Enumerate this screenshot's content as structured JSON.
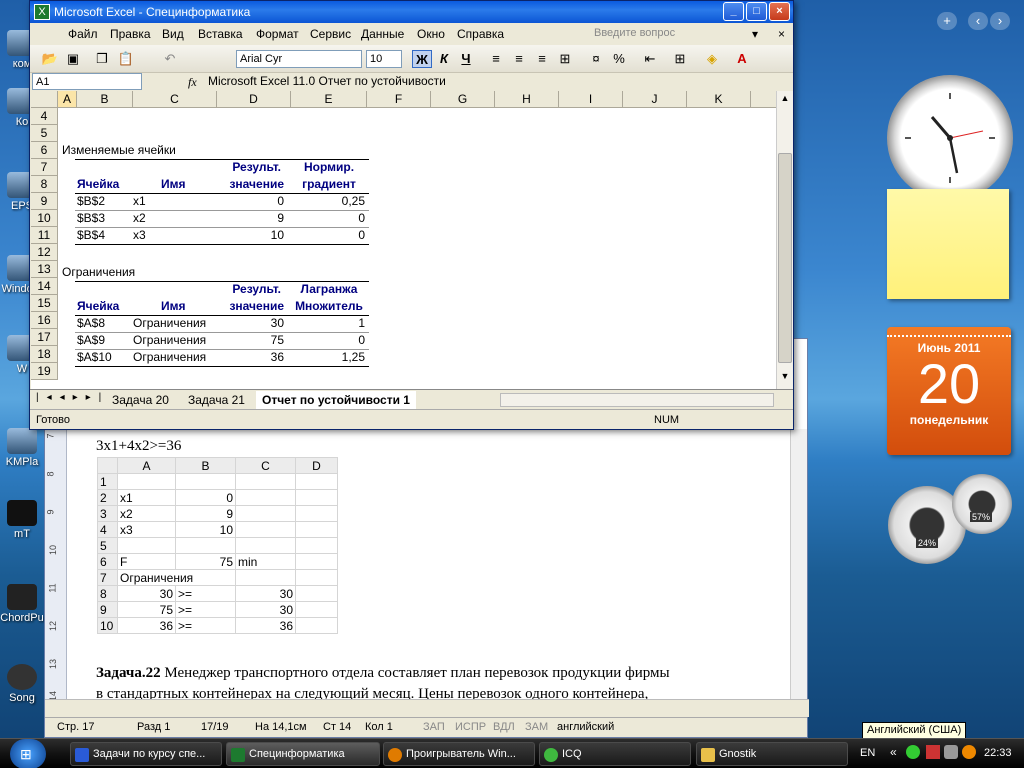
{
  "desktop": {
    "icons": [
      "ком",
      "Ко",
      "EPS",
      "Windo F",
      "W",
      "KMPla",
      "mT",
      "ChordPu",
      "Song"
    ]
  },
  "sidebar": {
    "add": "+",
    "prev": "‹",
    "next": "›"
  },
  "calendar": {
    "month_year": "Июнь 2011",
    "day": "20",
    "weekday": "понедельник"
  },
  "gauges": {
    "cpu": "24%",
    "mem": "57%"
  },
  "excel": {
    "title": "Microsoft Excel - Специнформатика",
    "menu": [
      "Файл",
      "Правка",
      "Вид",
      "Вставка",
      "Формат",
      "Сервис",
      "Данные",
      "Окно",
      "Справка"
    ],
    "help_placeholder": "Введите вопрос",
    "font_name": "Arial Cyr",
    "font_size": "10",
    "bold": "Ж",
    "italic": "К",
    "underline": "Ч",
    "percent": "%",
    "name_box": "A1",
    "fx": "fx",
    "formula": "Microsoft Excel 11.0 Отчет по устойчивости",
    "columns": [
      "A",
      "B",
      "C",
      "D",
      "E",
      "F",
      "G",
      "H",
      "I",
      "J",
      "K"
    ],
    "rows": [
      "4",
      "5",
      "6",
      "7",
      "8",
      "9",
      "10",
      "11",
      "12",
      "13",
      "14",
      "15",
      "16",
      "17",
      "18",
      "19"
    ],
    "section1": "Изменяемые ячейки",
    "section2": "Ограничения",
    "hdr_cell": "Ячейка",
    "hdr_name": "Имя",
    "hdr_result_1": "Результ.",
    "hdr_result_2": "значение",
    "hdr_norm_1": "Нормир.",
    "hdr_norm_2": "градиент",
    "hdr_lagr_1": "Лагранжа",
    "hdr_lagr_2": "Множитель",
    "vars": [
      {
        "cell": "$B$2",
        "name": "x1",
        "value": "0",
        "grad": "0,25"
      },
      {
        "cell": "$B$3",
        "name": "x2",
        "value": "9",
        "grad": "0"
      },
      {
        "cell": "$B$4",
        "name": "x3",
        "value": "10",
        "grad": "0"
      }
    ],
    "constraints": [
      {
        "cell": "$A$8",
        "name": "Ограничения",
        "value": "30",
        "mult": "1"
      },
      {
        "cell": "$A$9",
        "name": "Ограничения",
        "value": "75",
        "mult": "0"
      },
      {
        "cell": "$A$10",
        "name": "Ограничения",
        "value": "36",
        "mult": "1,25"
      }
    ],
    "sheet_tabs": [
      "Задача 20",
      "Задача 21",
      "Отчет по устойчивости 1"
    ],
    "status_left": "Готово",
    "status_num": "NUM"
  },
  "word": {
    "formula_line": "3x1+4x2>=36",
    "mini_cols": [
      "A",
      "B",
      "C",
      "D"
    ],
    "mini_rows": [
      {
        "r": "1",
        "a": "",
        "b": "",
        "c": ""
      },
      {
        "r": "2",
        "a": "x1",
        "b": "0",
        "c": ""
      },
      {
        "r": "3",
        "a": "x2",
        "b": "9",
        "c": ""
      },
      {
        "r": "4",
        "a": "x3",
        "b": "10",
        "c": ""
      },
      {
        "r": "5",
        "a": "",
        "b": "",
        "c": ""
      },
      {
        "r": "6",
        "a": "F",
        "b": "75",
        "c": "min"
      },
      {
        "r": "7",
        "a": "Ограничения",
        "b": "",
        "c": ""
      },
      {
        "r": "8",
        "a": "30",
        "b": ">=",
        "c": "30"
      },
      {
        "r": "9",
        "a": "75",
        "b": ">=",
        "c": "30"
      },
      {
        "r": "10",
        "a": "36",
        "b": ">=",
        "c": "36"
      }
    ],
    "task_bold": "Задача.22",
    "task_text": " Менеджер транспортного отдела составляет план перевозок продукции фирмы",
    "task_text2": "в стандартных контейнерах на следующий месяц. Цены перевозок одного контейнера,",
    "ruler": [
      "7",
      "8",
      "9",
      "10",
      "11",
      "12",
      "13",
      "14"
    ],
    "status": {
      "page": "Стр. 17",
      "section": "Разд 1",
      "pages": "17/19",
      "at": "На 14,1см",
      "line": "Ст 14",
      "col": "Кол 1",
      "rec": "ЗАП",
      "trk": "ИСПР",
      "ext": "ВДЛ",
      "ovr": "ЗАМ",
      "lang": "английский"
    }
  },
  "taskbar": {
    "items": [
      "Задачи по курсу спе...",
      "Специнформатика",
      "Проигрыватель Win...",
      "ICQ",
      "Gnostik"
    ],
    "lang": "EN",
    "time": "22:33",
    "tooltip": "Английский (США)"
  }
}
